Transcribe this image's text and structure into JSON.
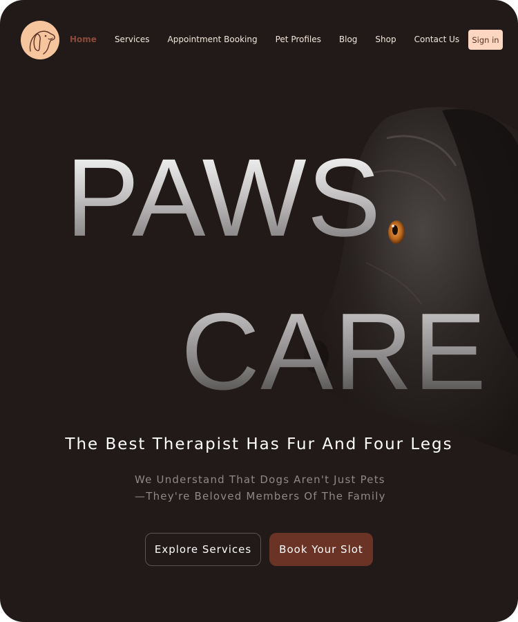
{
  "nav": {
    "items": [
      {
        "label": "Home",
        "active": true
      },
      {
        "label": "Services",
        "active": false
      },
      {
        "label": "Appointment Booking",
        "active": false
      },
      {
        "label": "Pet Profiles",
        "active": false
      },
      {
        "label": "Blog",
        "active": false
      },
      {
        "label": "Shop",
        "active": false
      },
      {
        "label": "Contact Us",
        "active": false
      }
    ],
    "sign_in": "Sign in"
  },
  "hero": {
    "word_1": "PAWS",
    "word_2": "CARE",
    "tagline": "The Best Therapist Has Fur And Four Legs",
    "subtext": "We Understand That Dogs Aren't Just Pets—They're Beloved Members Of The Family",
    "primary_button": "Book Your Slot",
    "secondary_button": "Explore Services"
  },
  "icons": {
    "logo": "dog-head-logo-icon"
  },
  "colors": {
    "background": "#211a18",
    "accent": "#6b3326",
    "active_nav": "#8a4a3a",
    "sign_in_bg": "#fcd6c1",
    "logo_bg": "#f6c59d"
  }
}
